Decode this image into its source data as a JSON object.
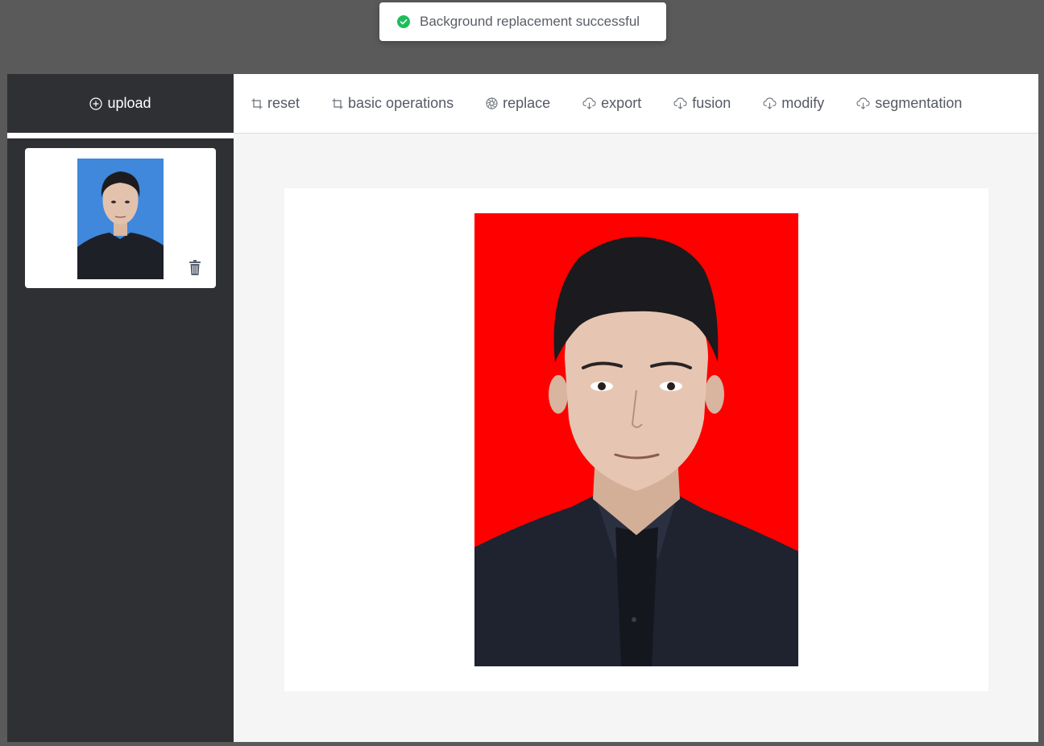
{
  "toast": {
    "message": "Background replacement successful",
    "status_color": "#1fbd5a"
  },
  "sidebar": {
    "upload_label": "upload",
    "thumbnails": [
      {
        "background_color": "#3f88dc",
        "delete_icon": "trash-icon"
      }
    ]
  },
  "toolbar": {
    "items": [
      {
        "label": "reset",
        "icon": "crop-icon"
      },
      {
        "label": "basic operations",
        "icon": "crop-icon"
      },
      {
        "label": "replace",
        "icon": "aperture-icon"
      },
      {
        "label": "export",
        "icon": "cloud-download-icon"
      },
      {
        "label": "fusion",
        "icon": "cloud-download-icon"
      },
      {
        "label": "modify",
        "icon": "cloud-download-icon"
      },
      {
        "label": "segmentation",
        "icon": "cloud-download-icon"
      }
    ]
  },
  "canvas": {
    "background_color": "#ff0000"
  }
}
